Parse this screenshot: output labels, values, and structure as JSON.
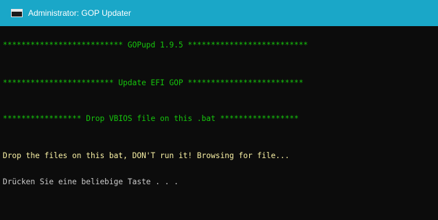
{
  "window": {
    "title": "Administrator:  GOP Updater"
  },
  "console": {
    "lines": [
      {
        "text": "************************** GOPupd 1.9.5 **************************",
        "color": "#16c60c"
      },
      {
        "text": "************************ Update EFI GOP *************************",
        "color": "#16c60c"
      },
      {
        "text": "***************** Drop VBIOS file on this .bat *****************",
        "color": "#16c60c"
      },
      {
        "text": "Drop the files on this bat, DON'T run it! Browsing for file...",
        "color": "#f9f1a5"
      },
      {
        "text": "Drücken Sie eine beliebige Taste . . .",
        "color": "#cccccc"
      }
    ]
  }
}
